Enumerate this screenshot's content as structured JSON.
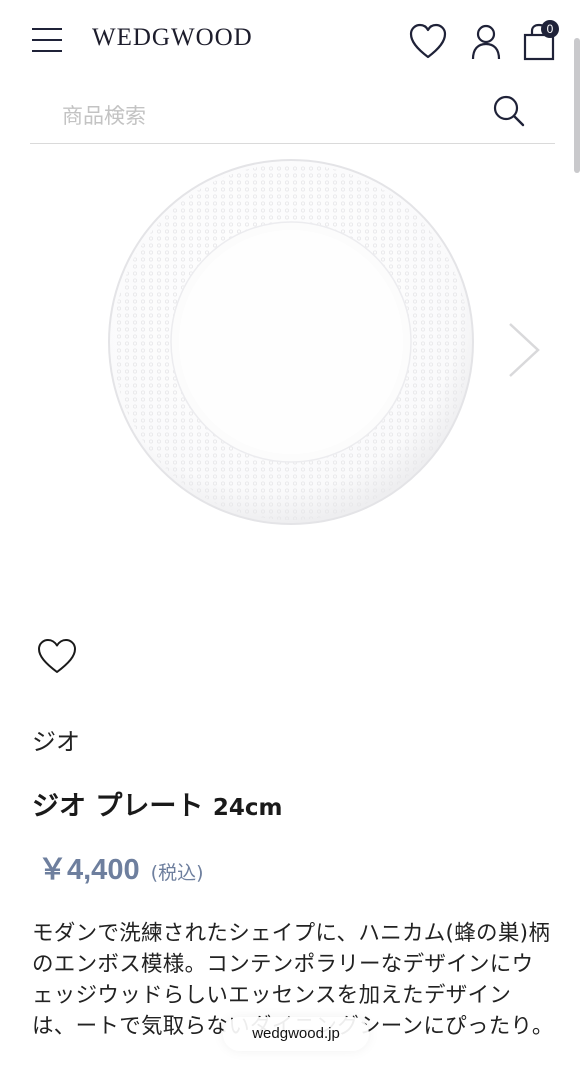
{
  "header": {
    "logo": "WEDGWOOD",
    "cart_count": "0",
    "icons": [
      "hamburger-menu-icon",
      "heart-icon",
      "user-icon",
      "shopping-bag-icon"
    ]
  },
  "search": {
    "placeholder": "商品検索",
    "icon": "search-icon"
  },
  "gallery": {
    "image": "white-embossed-plate",
    "next_icon": "chevron-right-icon"
  },
  "product": {
    "brand": "ジオ",
    "title": "ジオ プレート",
    "size": "24cm",
    "price": "￥4,400",
    "tax_note": "(税込)",
    "description": "モダンで洗練されたシェイプに、ハニカム(蜂の巣)柄のエンボス模様。コンテンポラリーなデザインにウェッジウッドらしいエッセンスを加えたデザインは、ートで気取らないダイニングシーンにぴったり。"
  },
  "browser": {
    "url": "wedgwood.jp"
  },
  "colors": {
    "price": "#6e7f9e",
    "logo": "#1d1d2c",
    "icons": "#1f2238"
  }
}
